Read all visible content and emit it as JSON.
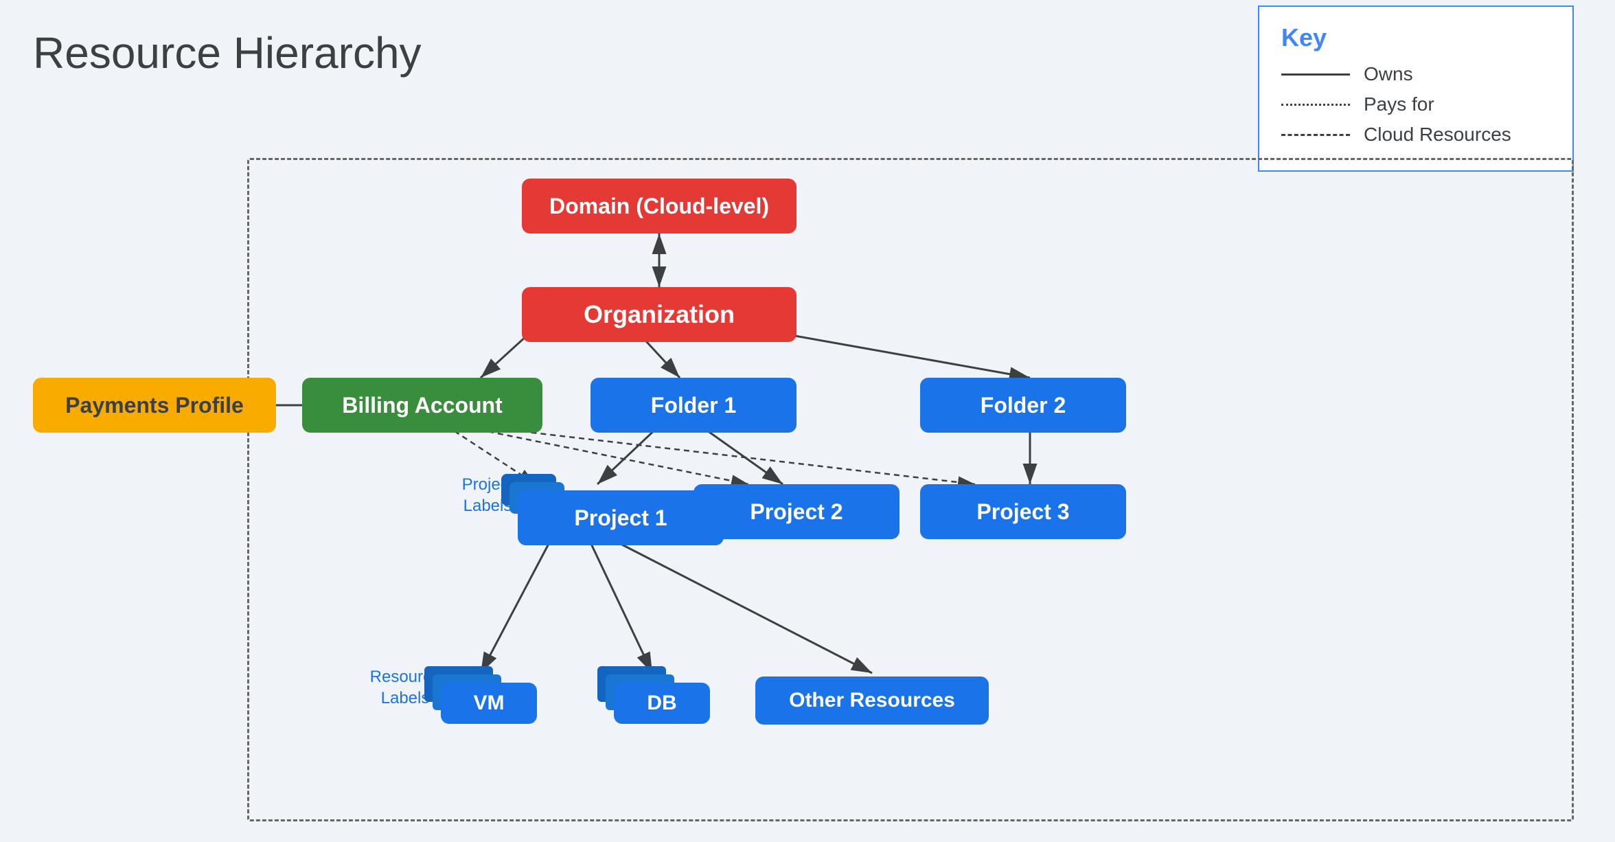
{
  "title": "Resource Hierarchy",
  "key": {
    "title": "Key",
    "items": [
      {
        "label": "Owns",
        "line_type": "solid"
      },
      {
        "label": "Pays for",
        "line_type": "dotted"
      },
      {
        "label": "Cloud Resources",
        "line_type": "dashed"
      }
    ]
  },
  "nodes": {
    "domain": "Domain (Cloud-level)",
    "organization": "Organization",
    "billing_account": "Billing Account",
    "payments_profile": "Payments Profile",
    "folder1": "Folder 1",
    "folder2": "Folder 2",
    "project1": "Project 1",
    "project2": "Project 2",
    "project3": "Project 3",
    "vm": "VM",
    "db": "DB",
    "other_resources": "Other Resources"
  },
  "labels": {
    "project_labels": "Project\nLabels",
    "resource_labels": "Resource\nLabels"
  }
}
